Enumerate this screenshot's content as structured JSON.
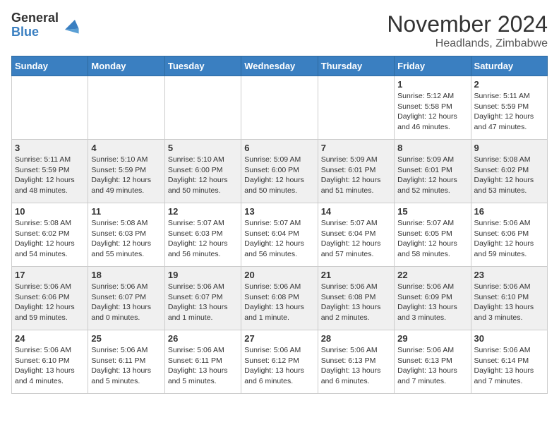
{
  "logo": {
    "general": "General",
    "blue": "Blue"
  },
  "title": "November 2024",
  "location": "Headlands, Zimbabwe",
  "weekdays": [
    "Sunday",
    "Monday",
    "Tuesday",
    "Wednesday",
    "Thursday",
    "Friday",
    "Saturday"
  ],
  "weeks": [
    [
      {
        "day": "",
        "info": ""
      },
      {
        "day": "",
        "info": ""
      },
      {
        "day": "",
        "info": ""
      },
      {
        "day": "",
        "info": ""
      },
      {
        "day": "",
        "info": ""
      },
      {
        "day": "1",
        "info": "Sunrise: 5:12 AM\nSunset: 5:58 PM\nDaylight: 12 hours\nand 46 minutes."
      },
      {
        "day": "2",
        "info": "Sunrise: 5:11 AM\nSunset: 5:59 PM\nDaylight: 12 hours\nand 47 minutes."
      }
    ],
    [
      {
        "day": "3",
        "info": "Sunrise: 5:11 AM\nSunset: 5:59 PM\nDaylight: 12 hours\nand 48 minutes."
      },
      {
        "day": "4",
        "info": "Sunrise: 5:10 AM\nSunset: 5:59 PM\nDaylight: 12 hours\nand 49 minutes."
      },
      {
        "day": "5",
        "info": "Sunrise: 5:10 AM\nSunset: 6:00 PM\nDaylight: 12 hours\nand 50 minutes."
      },
      {
        "day": "6",
        "info": "Sunrise: 5:09 AM\nSunset: 6:00 PM\nDaylight: 12 hours\nand 50 minutes."
      },
      {
        "day": "7",
        "info": "Sunrise: 5:09 AM\nSunset: 6:01 PM\nDaylight: 12 hours\nand 51 minutes."
      },
      {
        "day": "8",
        "info": "Sunrise: 5:09 AM\nSunset: 6:01 PM\nDaylight: 12 hours\nand 52 minutes."
      },
      {
        "day": "9",
        "info": "Sunrise: 5:08 AM\nSunset: 6:02 PM\nDaylight: 12 hours\nand 53 minutes."
      }
    ],
    [
      {
        "day": "10",
        "info": "Sunrise: 5:08 AM\nSunset: 6:02 PM\nDaylight: 12 hours\nand 54 minutes."
      },
      {
        "day": "11",
        "info": "Sunrise: 5:08 AM\nSunset: 6:03 PM\nDaylight: 12 hours\nand 55 minutes."
      },
      {
        "day": "12",
        "info": "Sunrise: 5:07 AM\nSunset: 6:03 PM\nDaylight: 12 hours\nand 56 minutes."
      },
      {
        "day": "13",
        "info": "Sunrise: 5:07 AM\nSunset: 6:04 PM\nDaylight: 12 hours\nand 56 minutes."
      },
      {
        "day": "14",
        "info": "Sunrise: 5:07 AM\nSunset: 6:04 PM\nDaylight: 12 hours\nand 57 minutes."
      },
      {
        "day": "15",
        "info": "Sunrise: 5:07 AM\nSunset: 6:05 PM\nDaylight: 12 hours\nand 58 minutes."
      },
      {
        "day": "16",
        "info": "Sunrise: 5:06 AM\nSunset: 6:06 PM\nDaylight: 12 hours\nand 59 minutes."
      }
    ],
    [
      {
        "day": "17",
        "info": "Sunrise: 5:06 AM\nSunset: 6:06 PM\nDaylight: 12 hours\nand 59 minutes."
      },
      {
        "day": "18",
        "info": "Sunrise: 5:06 AM\nSunset: 6:07 PM\nDaylight: 13 hours\nand 0 minutes."
      },
      {
        "day": "19",
        "info": "Sunrise: 5:06 AM\nSunset: 6:07 PM\nDaylight: 13 hours\nand 1 minute."
      },
      {
        "day": "20",
        "info": "Sunrise: 5:06 AM\nSunset: 6:08 PM\nDaylight: 13 hours\nand 1 minute."
      },
      {
        "day": "21",
        "info": "Sunrise: 5:06 AM\nSunset: 6:08 PM\nDaylight: 13 hours\nand 2 minutes."
      },
      {
        "day": "22",
        "info": "Sunrise: 5:06 AM\nSunset: 6:09 PM\nDaylight: 13 hours\nand 3 minutes."
      },
      {
        "day": "23",
        "info": "Sunrise: 5:06 AM\nSunset: 6:10 PM\nDaylight: 13 hours\nand 3 minutes."
      }
    ],
    [
      {
        "day": "24",
        "info": "Sunrise: 5:06 AM\nSunset: 6:10 PM\nDaylight: 13 hours\nand 4 minutes."
      },
      {
        "day": "25",
        "info": "Sunrise: 5:06 AM\nSunset: 6:11 PM\nDaylight: 13 hours\nand 5 minutes."
      },
      {
        "day": "26",
        "info": "Sunrise: 5:06 AM\nSunset: 6:11 PM\nDaylight: 13 hours\nand 5 minutes."
      },
      {
        "day": "27",
        "info": "Sunrise: 5:06 AM\nSunset: 6:12 PM\nDaylight: 13 hours\nand 6 minutes."
      },
      {
        "day": "28",
        "info": "Sunrise: 5:06 AM\nSunset: 6:13 PM\nDaylight: 13 hours\nand 6 minutes."
      },
      {
        "day": "29",
        "info": "Sunrise: 5:06 AM\nSunset: 6:13 PM\nDaylight: 13 hours\nand 7 minutes."
      },
      {
        "day": "30",
        "info": "Sunrise: 5:06 AM\nSunset: 6:14 PM\nDaylight: 13 hours\nand 7 minutes."
      }
    ]
  ]
}
